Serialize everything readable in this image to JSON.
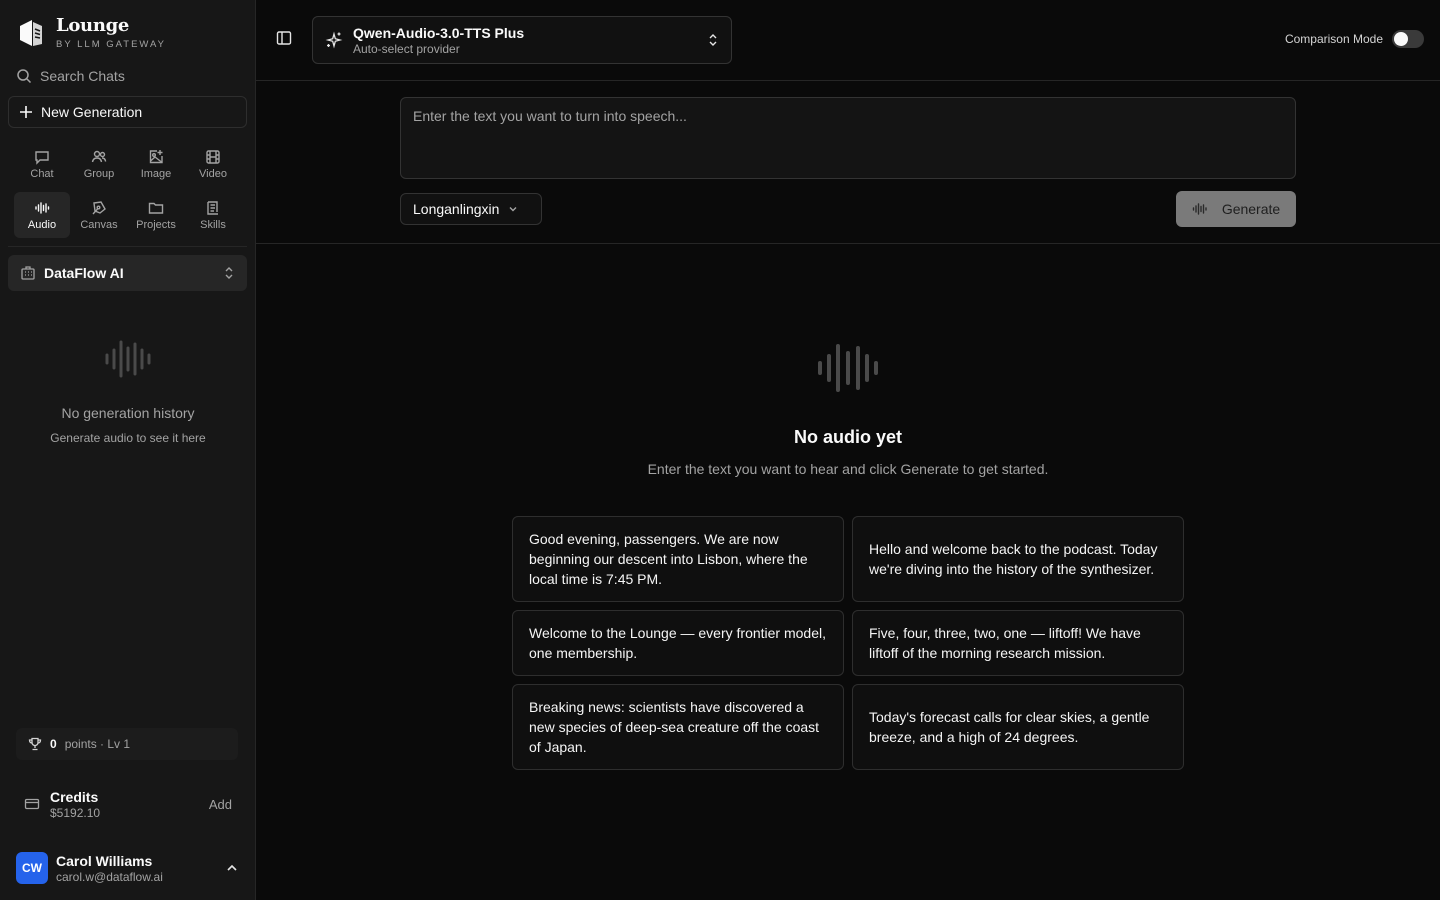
{
  "brand": {
    "name": "Lounge",
    "subtitle": "BY LLM GATEWAY"
  },
  "sidebar": {
    "search_label": "Search Chats",
    "new_generation_label": "New Generation",
    "modes": [
      {
        "label": "Chat",
        "icon": "chat-icon",
        "active": false
      },
      {
        "label": "Group",
        "icon": "group-icon",
        "active": false
      },
      {
        "label": "Image",
        "icon": "image-icon",
        "active": false
      },
      {
        "label": "Video",
        "icon": "video-icon",
        "active": false
      },
      {
        "label": "Audio",
        "icon": "audio-icon",
        "active": true
      },
      {
        "label": "Canvas",
        "icon": "canvas-icon",
        "active": false
      },
      {
        "label": "Projects",
        "icon": "folder-icon",
        "active": false
      },
      {
        "label": "Skills",
        "icon": "skills-icon",
        "active": false
      }
    ],
    "organization": "DataFlow AI",
    "history_empty_title": "No generation history",
    "history_empty_sub": "Generate audio to see it here",
    "points": {
      "value": "0",
      "label": "points · Lv 1"
    },
    "credits": {
      "title": "Credits",
      "amount": "$5192.10",
      "add_label": "Add"
    },
    "user": {
      "initials": "CW",
      "name": "Carol Williams",
      "email": "carol.w@dataflow.ai"
    }
  },
  "header": {
    "model_name": "Qwen-Audio-3.0-TTS Plus",
    "model_provider": "Auto-select provider",
    "comparison_label": "Comparison Mode",
    "comparison_on": false
  },
  "input": {
    "placeholder": "Enter the text you want to turn into speech...",
    "voice": "Longanlingxin",
    "generate_label": "Generate"
  },
  "empty_state": {
    "title": "No audio yet",
    "subtitle": "Enter the text you want to hear and click Generate to get started."
  },
  "suggestions": [
    "Good evening, passengers. We are now beginning our descent into Lisbon, where the local time is 7:45 PM.",
    "Hello and welcome back to the podcast. Today we're diving into the history of the synthesizer.",
    "Welcome to the Lounge — every frontier model, one membership.",
    "Five, four, three, two, one — liftoff! We have liftoff of the morning research mission.",
    "Breaking news: scientists have discovered a new species of deep-sea creature off the coast of Japan.",
    "Today's forecast calls for clear skies, a gentle breeze, and a high of 24 degrees."
  ],
  "colors": {
    "accent": "#2563eb",
    "background": "#0a0a0a",
    "sidebar": "#171717"
  }
}
